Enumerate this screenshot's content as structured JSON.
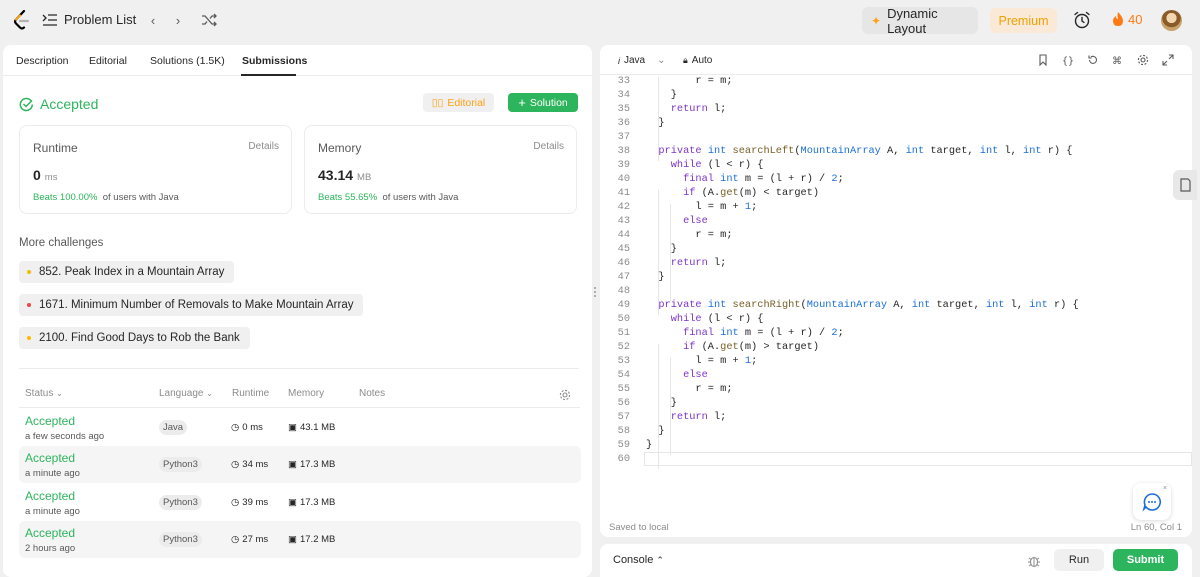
{
  "header": {
    "problem_list_label": "Problem List",
    "dynamic_layout_label": "Dynamic Layout",
    "premium_label": "Premium",
    "streak_count": "40",
    "colors": {
      "accent": "#ffa116",
      "green": "#2db55d"
    }
  },
  "left": {
    "tabs": [
      {
        "label": "Description"
      },
      {
        "label": "Editorial"
      },
      {
        "label": "Solutions (1.5K)"
      },
      {
        "label": "Submissions"
      }
    ],
    "status": "Accepted",
    "editorial_button": "Editorial",
    "solution_button": "Solution",
    "runtime": {
      "title": "Runtime",
      "details": "Details",
      "value": "0",
      "unit": "ms",
      "beats": "Beats 100.00%",
      "beats_suffix": "of users with Java"
    },
    "memory": {
      "title": "Memory",
      "details": "Details",
      "value": "43.14",
      "unit": "MB",
      "beats": "Beats 55.65%",
      "beats_suffix": "of users with Java"
    },
    "more_challenges_title": "More challenges",
    "challenges": [
      {
        "label": "852. Peak Index in a Mountain Array",
        "difficulty_color": "#ffb800"
      },
      {
        "label": "1671. Minimum Number of Removals to Make Mountain Array",
        "difficulty_color": "#ef4743"
      },
      {
        "label": "2100. Find Good Days to Rob the Bank",
        "difficulty_color": "#ffb800"
      }
    ],
    "table_headers": {
      "status": "Status",
      "language": "Language",
      "runtime": "Runtime",
      "memory": "Memory",
      "notes": "Notes"
    },
    "submissions": [
      {
        "status": "Accepted",
        "time": "a few seconds ago",
        "language": "Java",
        "runtime": "0 ms",
        "memory": "43.1 MB"
      },
      {
        "status": "Accepted",
        "time": "a minute ago",
        "language": "Python3",
        "runtime": "34 ms",
        "memory": "17.3 MB"
      },
      {
        "status": "Accepted",
        "time": "a minute ago",
        "language": "Python3",
        "runtime": "39 ms",
        "memory": "17.3 MB"
      },
      {
        "status": "Accepted",
        "time": "2 hours ago",
        "language": "Python3",
        "runtime": "27 ms",
        "memory": "17.2 MB"
      }
    ]
  },
  "editor": {
    "language": "Java",
    "mode": "Auto",
    "saved_text": "Saved to local",
    "cursor_position": "Ln 60, Col 1",
    "line_numbers": [
      "33",
      "34",
      "35",
      "36",
      "37",
      "38",
      "39",
      "40",
      "41",
      "42",
      "43",
      "44",
      "45",
      "46",
      "47",
      "48",
      "49",
      "50",
      "51",
      "52",
      "53",
      "54",
      "55",
      "56",
      "57",
      "58",
      "59",
      "60"
    ]
  },
  "console": {
    "label": "Console",
    "run_label": "Run",
    "submit_label": "Submit"
  }
}
